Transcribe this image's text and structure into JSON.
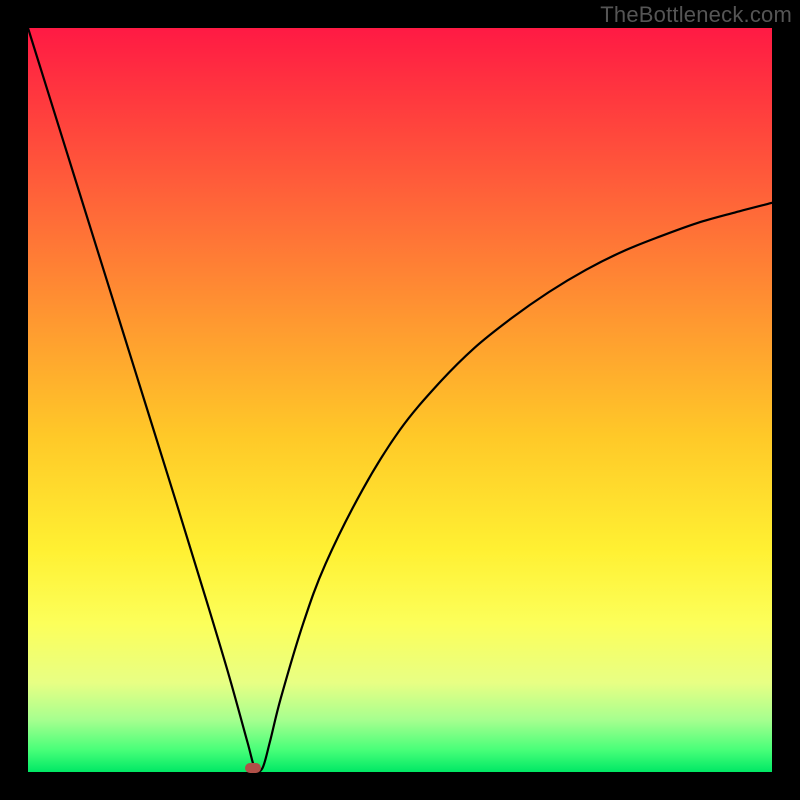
{
  "attribution": "TheBottleneck.com",
  "colors": {
    "frame": "#000000",
    "gradient_top": "#ff1a44",
    "gradient_bottom": "#00e865",
    "curve": "#000000",
    "marker": "#b05048",
    "attribution_text": "#555555"
  },
  "chart_data": {
    "type": "line",
    "title": "",
    "xlabel": "",
    "ylabel": "",
    "xlim": [
      0,
      100
    ],
    "ylim": [
      0,
      100
    ],
    "series": [
      {
        "name": "bottleneck-curve",
        "x": [
          0,
          5,
          10,
          15,
          20,
          24,
          27,
          29.5,
          30.5,
          31.5,
          32.5,
          34,
          37,
          40,
          45,
          50,
          55,
          60,
          65,
          70,
          75,
          80,
          85,
          90,
          95,
          100
        ],
        "y": [
          100,
          84,
          68,
          52,
          36,
          23,
          13,
          4,
          0.5,
          0.5,
          4,
          10,
          20,
          28,
          38,
          46,
          52,
          57,
          61,
          64.5,
          67.5,
          70,
          72,
          73.8,
          75.2,
          76.5
        ]
      }
    ],
    "annotations": [
      {
        "name": "minimum-marker",
        "x": 30.2,
        "y": 0.6
      }
    ]
  }
}
